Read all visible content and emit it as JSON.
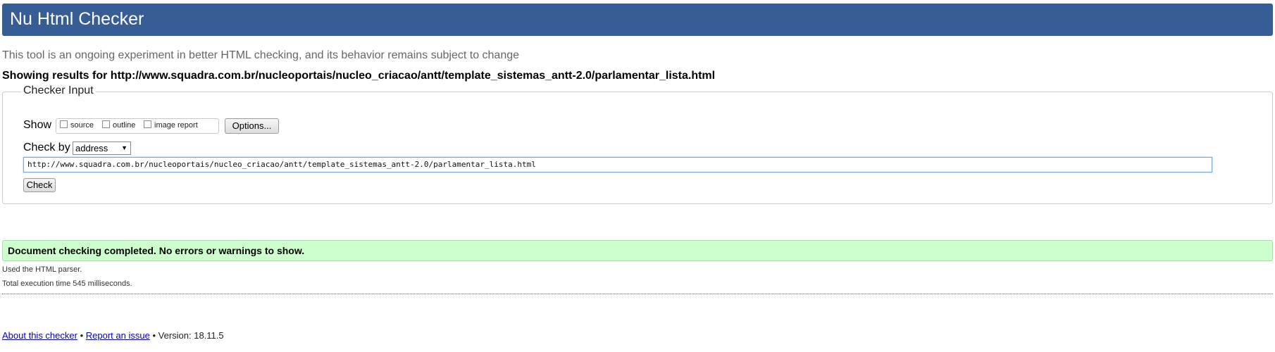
{
  "header": {
    "title": "Nu Html Checker",
    "color": "#365d95"
  },
  "tagline": "This tool is an ongoing experiment in better HTML checking, and its behavior remains subject to change",
  "showing_results": "Showing results for http://www.squadra.com.br/nucleoportais/nucleo_criacao/antt/template_sistemas_antt-2.0/parlamentar_lista.html",
  "checker_input": {
    "legend": "Checker Input",
    "show_label": "Show",
    "options": [
      {
        "label": "source",
        "checked": false
      },
      {
        "label": "outline",
        "checked": false
      },
      {
        "label": "image report",
        "checked": false
      }
    ],
    "options_button": "Options...",
    "check_by_label": "Check by",
    "check_by_value": "address",
    "url_value": "http://www.squadra.com.br/nucleoportais/nucleo_criacao/antt/template_sistemas_antt-2.0/parlamentar_lista.html",
    "check_button": "Check"
  },
  "result": {
    "message": "Document checking completed. No errors or warnings to show.",
    "color": "#ccffcc"
  },
  "details": {
    "parser": "Used the HTML parser.",
    "execution_time": "Total execution time 545 milliseconds."
  },
  "footer": {
    "about_link": "About this checker",
    "separator": "•",
    "report_link": "Report an issue",
    "version": "Version: 18.11.5"
  }
}
